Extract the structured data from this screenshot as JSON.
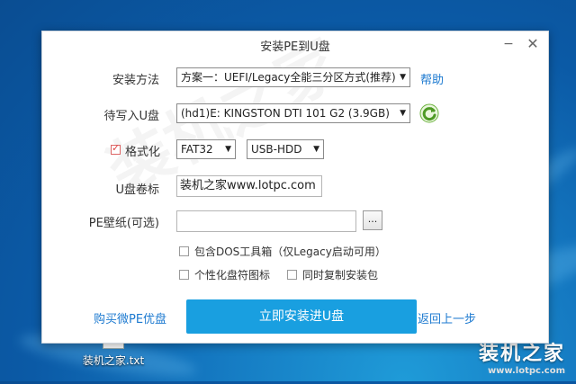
{
  "dialog": {
    "title": "安装PE到U盘",
    "minimize": "−",
    "close": "✕",
    "install_method": {
      "label": "安装方法",
      "value": "方案一：UEFI/Legacy全能三分区方式(推荐)",
      "help": "帮助"
    },
    "target_drive": {
      "label": "待写入U盘",
      "value": "(hd1)E: KINGSTON DTI 101 G2 (3.9GB)"
    },
    "format": {
      "label": "格式化",
      "checked": true,
      "filesystem": "FAT32",
      "mode": "USB-HDD"
    },
    "volume_label": {
      "label": "U盘卷标",
      "value": "装机之家www.lotpc.com"
    },
    "wallpaper": {
      "label": "PE壁纸(可选)",
      "value": "",
      "browse": "..."
    },
    "options": [
      {
        "label": "包含DOS工具箱（仅Legacy启动可用）",
        "checked": false
      },
      {
        "label": "个性化盘符图标",
        "checked": false
      },
      {
        "label": "同时复制安装包",
        "checked": false
      }
    ],
    "buy_link": "购买微PE优盘",
    "install_button": "立即安装进U盘",
    "back_link": "返回上一步",
    "watermark": "装机之家"
  },
  "desktop": {
    "file_label": "装机之家.txt",
    "corner_brand": "装机之家",
    "corner_url": "www.lotpc.com"
  }
}
